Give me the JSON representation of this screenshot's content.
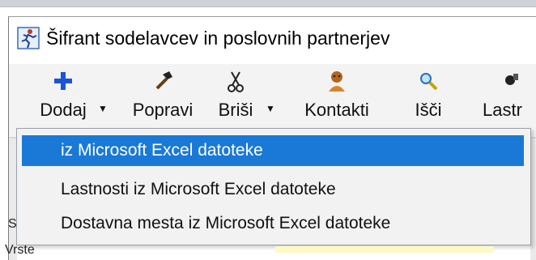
{
  "window": {
    "title": "Šifrant sodelavcev in poslovnih partnerjev",
    "icon": "runner-app-icon"
  },
  "toolbar": {
    "buttons": [
      {
        "label": "Dodaj",
        "icon": "plus-icon",
        "has_dropdown": true
      },
      {
        "label": "Popravi",
        "icon": "hammer-icon",
        "has_dropdown": false
      },
      {
        "label": "Briši",
        "icon": "scissors-icon",
        "has_dropdown": true
      },
      {
        "label": "Kontakti",
        "icon": "contacts-icon",
        "has_dropdown": false
      },
      {
        "label": "Išči",
        "icon": "magnifier-icon",
        "has_dropdown": false
      },
      {
        "label": "Lastr",
        "icon": "properties-icon",
        "has_dropdown": false
      }
    ]
  },
  "dropdown_menu": {
    "items": [
      {
        "label": "iz Microsoft Excel datoteke",
        "selected": true
      },
      {
        "label": "Lastnosti iz Microsoft Excel datoteke",
        "selected": false
      },
      {
        "label": "Dostavna mesta iz Microsoft Excel datoteke",
        "selected": false
      }
    ]
  },
  "colors": {
    "selection": "#1a79d6",
    "menu_bg": "#f2f2f2",
    "plus_icon": "#1a55d6"
  },
  "partial_text": {
    "bottom_left": "Vrste",
    "left_edge_s": "S"
  }
}
